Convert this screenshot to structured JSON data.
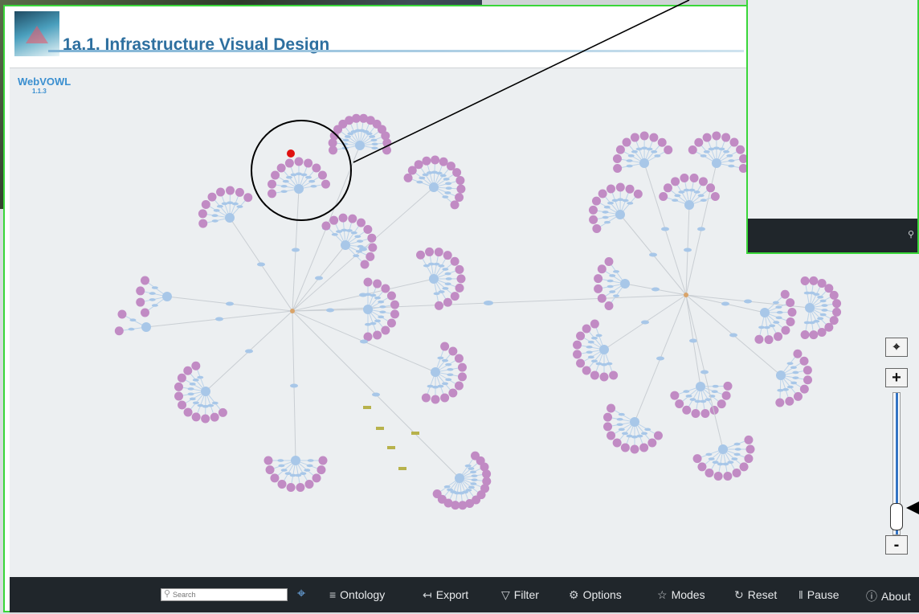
{
  "header": {
    "title": "1a.1. Infrastructure Visual Design"
  },
  "app": {
    "name": "WebVOWL",
    "version": "1.1.3"
  },
  "colors": {
    "class_node": "#c18bc4",
    "property_node": "#a8c7e8",
    "highlight_node": "#e01010",
    "frame_border": "#39d639",
    "toolbar_bg": "#20262b",
    "zoom_fill": "#3474c4",
    "title_color": "#2d6f9f"
  },
  "toolbar": {
    "search_placeholder": "Search",
    "pin_icon": "locate-icon",
    "items": [
      {
        "label": "Ontology",
        "icon": "≡",
        "icon_name": "menu-icon"
      },
      {
        "label": "Export",
        "icon": "↤",
        "icon_name": "export-icon"
      },
      {
        "label": "Filter",
        "icon": "▽",
        "icon_name": "filter-icon"
      },
      {
        "label": "Options",
        "icon": "⚙",
        "icon_name": "gear-icon"
      },
      {
        "label": "Modes",
        "icon": "☆",
        "icon_name": "star-icon"
      },
      {
        "label": "Reset",
        "icon": "↻",
        "icon_name": "reset-icon"
      },
      {
        "label": "Pause",
        "icon": "‖",
        "icon_name": "pause-icon"
      },
      {
        "label": "About",
        "icon": "ⓘ",
        "icon_name": "info-icon"
      }
    ]
  },
  "zoom": {
    "center_label": "⌖",
    "zoom_in_label": "+",
    "zoom_out_label": "-",
    "level": 0.2
  },
  "overlay": {
    "search_icon": "search-icon"
  }
}
